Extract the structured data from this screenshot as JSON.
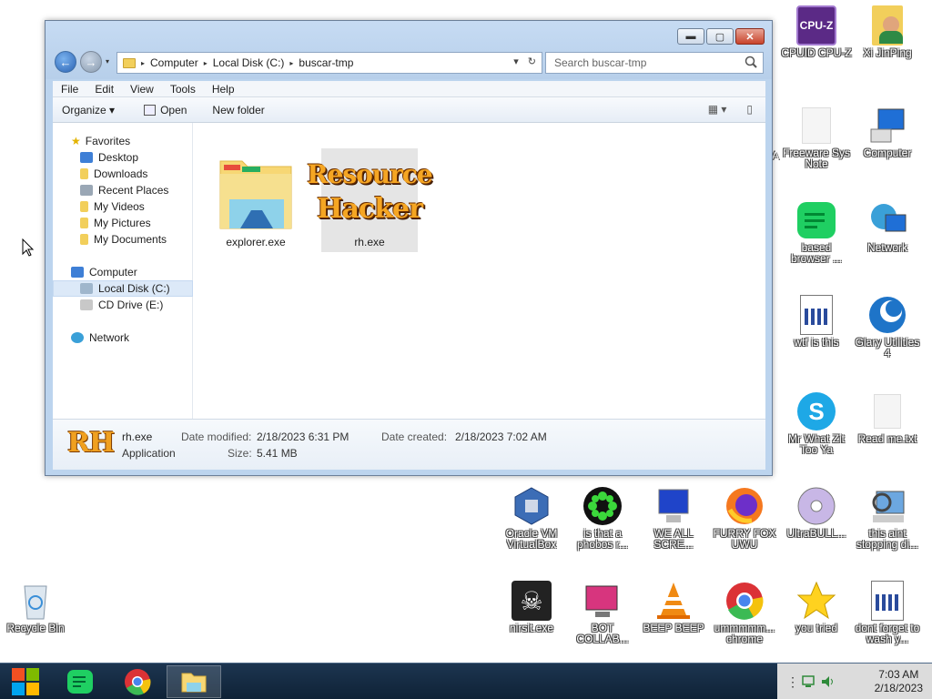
{
  "desktop": {
    "icons": [
      {
        "label": "CPUID CPU-Z"
      },
      {
        "label": "Xi JinPing"
      },
      {
        "label": "Freeware Sys Note"
      },
      {
        "label": "Computer"
      },
      {
        "label": "based browser ..."
      },
      {
        "label": "Network"
      },
      {
        "label": "wtf is this"
      },
      {
        "label": "Glary Utilities 4"
      },
      {
        "label": "Mr What Zit Too Ya"
      },
      {
        "label": "Read me.txt"
      },
      {
        "label": "Oracle VM VirtualBox"
      },
      {
        "label": "is that a phobos r..."
      },
      {
        "label": "WE ALL SCRE..."
      },
      {
        "label": "FURRY FOX UWU"
      },
      {
        "label": "UltraBULL..."
      },
      {
        "label": "this aint stopping di..."
      },
      {
        "label": "Recycle Bin"
      },
      {
        "label": "nirsit.exe"
      },
      {
        "label": "BOT COLLAB..."
      },
      {
        "label": "BEEP BEEP"
      },
      {
        "label": "ummmmm... chrome"
      },
      {
        "label": "you tried"
      },
      {
        "label": "dont forget to wash y..."
      }
    ],
    "partial_letter": "A"
  },
  "window": {
    "caption": {
      "minimize": "▬",
      "maximize": "▢",
      "close": "✕"
    },
    "nav": {
      "back": "←",
      "forward": "→",
      "dropdown": "▾"
    },
    "address": {
      "crumbs": [
        "Computer",
        "Local Disk (C:)",
        "buscar-tmp"
      ],
      "sep": "▸",
      "refresh": "↻",
      "dropdown": "▾"
    },
    "search": {
      "placeholder": "Search buscar-tmp"
    },
    "menu": [
      "File",
      "Edit",
      "View",
      "Tools",
      "Help"
    ],
    "toolbar": {
      "organize": "Organize ▾",
      "open": "Open",
      "new_folder": "New folder",
      "views": "▦ ▾",
      "preview": "▯"
    },
    "nav_pane": {
      "favorites": "Favorites",
      "fav_items": [
        "Desktop",
        "Downloads",
        "Recent Places",
        "My Videos",
        "My Pictures",
        "My Documents"
      ],
      "computer": "Computer",
      "computer_items": [
        "Local Disk (C:)",
        "CD Drive (E:)"
      ],
      "network": "Network"
    },
    "files": [
      {
        "name": "explorer.exe"
      },
      {
        "name": "rh.exe",
        "logo_line1": "Resource",
        "logo_line2": "Hacker"
      }
    ],
    "details": {
      "logo": "RH",
      "name": "rh.exe",
      "type": "Application",
      "modified_label": "Date modified:",
      "modified": "2/18/2023 6:31 PM",
      "size_label": "Size:",
      "size": "5.41 MB",
      "created_label": "Date created:",
      "created": "2/18/2023 7:02 AM"
    }
  },
  "taskbar": {
    "clock_time": "7:03 AM",
    "clock_date": "2/18/2023"
  }
}
